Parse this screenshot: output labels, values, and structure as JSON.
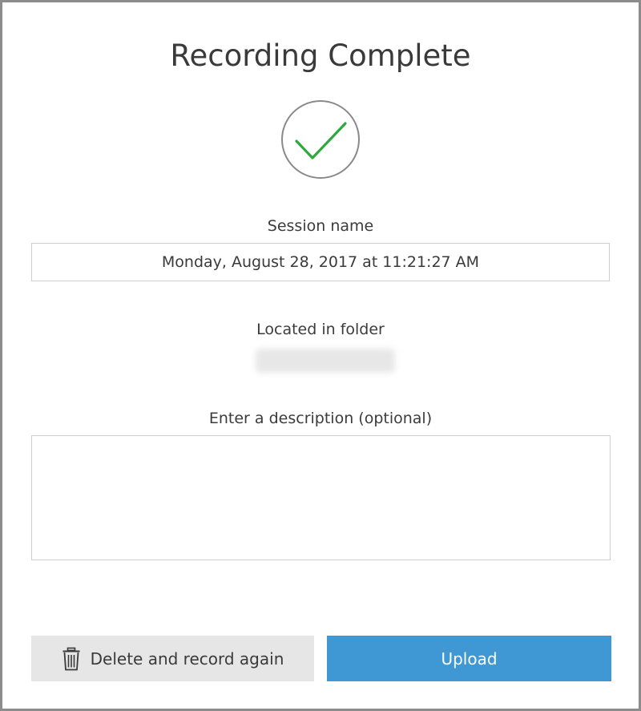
{
  "dialog": {
    "title": "Recording Complete",
    "status_icon": "checkmark-circle-icon",
    "accent_color": "#2eaa3c",
    "session": {
      "label": "Session name",
      "value": "Monday, August 28, 2017 at 11:21:27 AM"
    },
    "folder": {
      "label": "Located in folder"
    },
    "description": {
      "label": "Enter a description (optional)",
      "value": ""
    },
    "actions": {
      "delete_label": "Delete and record again",
      "delete_icon": "trash-icon",
      "upload_label": "Upload",
      "upload_color": "#3f98d4"
    }
  }
}
